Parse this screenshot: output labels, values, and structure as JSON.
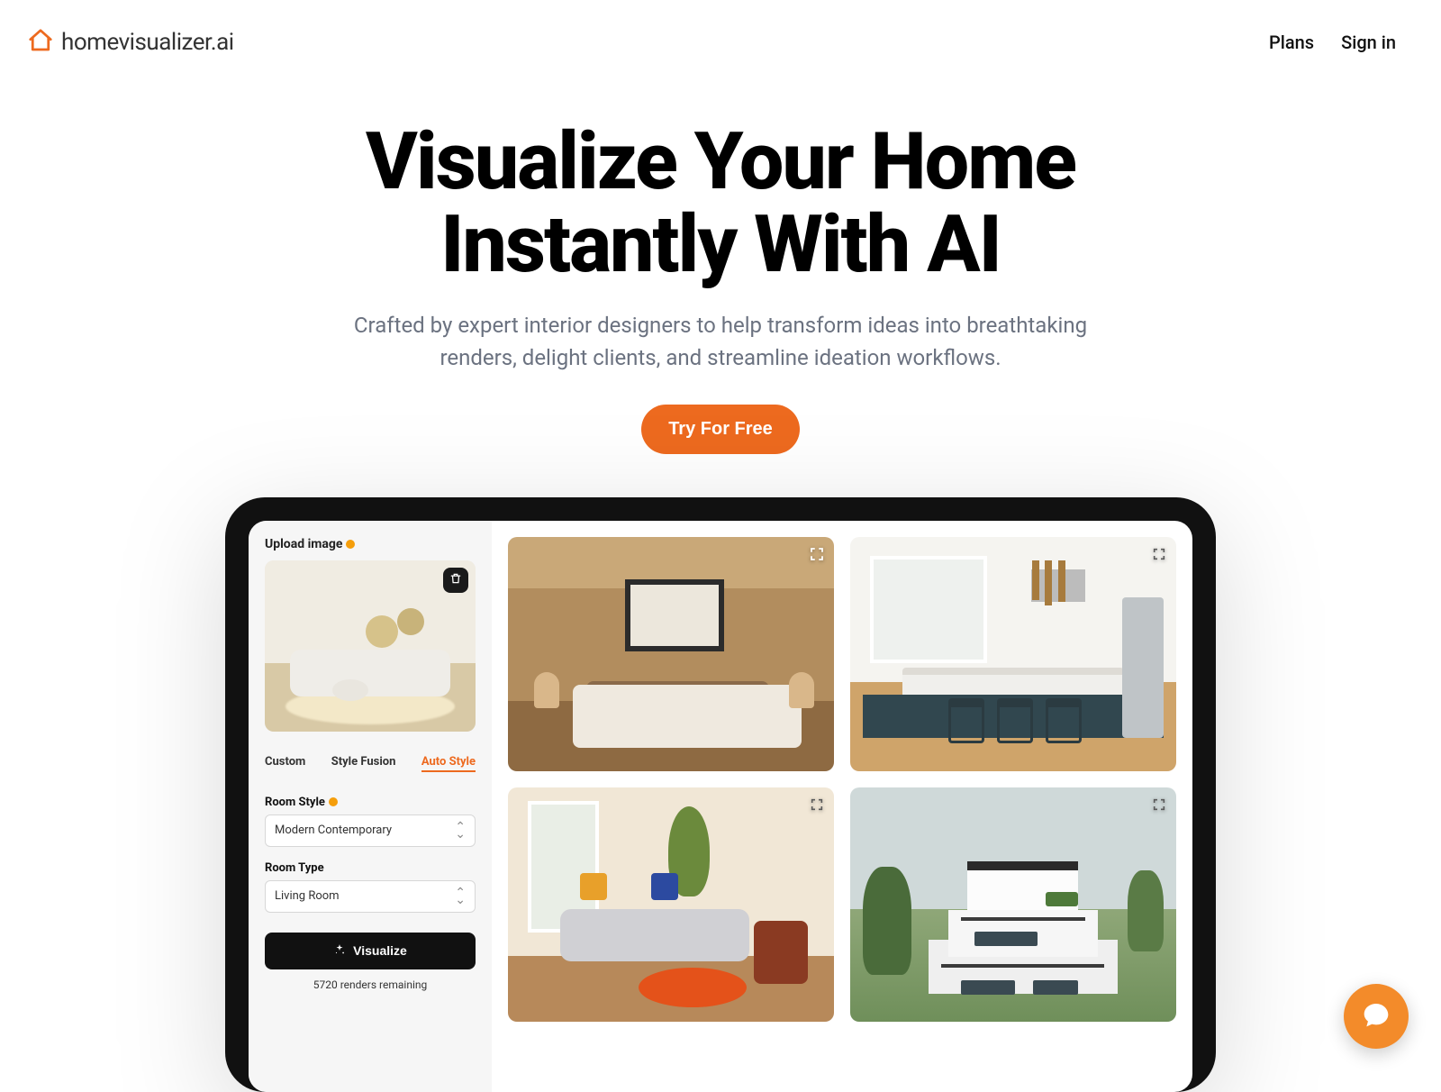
{
  "brand": {
    "name": "homevisualizer.ai"
  },
  "nav": {
    "plans": "Plans",
    "signin": "Sign in"
  },
  "hero": {
    "title_l1": "Visualize Your Home",
    "title_l2": "Instantly With AI",
    "subtitle": "Crafted by expert interior designers to help transform ideas into breathtaking renders, delight clients, and streamline ideation workflows.",
    "cta": "Try For Free"
  },
  "app": {
    "upload_label": "Upload image",
    "tabs": {
      "custom": "Custom",
      "style_fusion": "Style Fusion",
      "auto_style": "Auto Style"
    },
    "room_style": {
      "label": "Room Style",
      "value": "Modern Contemporary"
    },
    "room_type": {
      "label": "Room Type",
      "value": "Living Room"
    },
    "visualize_label": "Visualize",
    "remaining": "5720 renders remaining"
  }
}
